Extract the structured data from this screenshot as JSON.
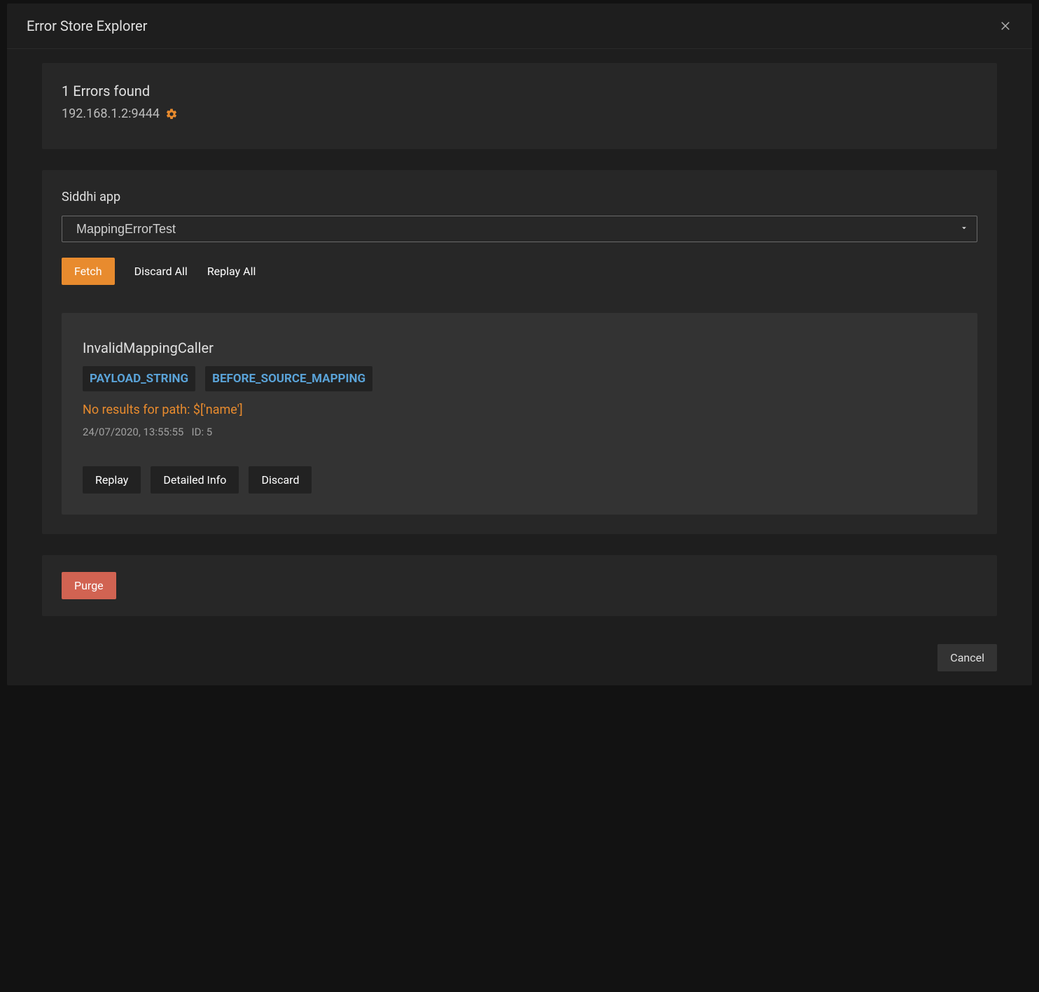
{
  "header": {
    "title": "Error Store Explorer"
  },
  "summary": {
    "errors_found": "1 Errors found",
    "host": "192.168.1.2:9444"
  },
  "main": {
    "section_label": "Siddhi app",
    "selected_app": "MappingErrorTest",
    "actions": {
      "fetch": "Fetch",
      "discard_all": "Discard All",
      "replay_all": "Replay All"
    },
    "error": {
      "title": "InvalidMappingCaller",
      "tags": [
        "PAYLOAD_STRING",
        "BEFORE_SOURCE_MAPPING"
      ],
      "message": "No results for path: $['name']",
      "timestamp": "24/07/2020, 13:55:55",
      "id_label": "ID: 5",
      "actions": {
        "replay": "Replay",
        "detailed_info": "Detailed Info",
        "discard": "Discard"
      }
    }
  },
  "purge": {
    "label": "Purge"
  },
  "footer": {
    "cancel": "Cancel"
  }
}
